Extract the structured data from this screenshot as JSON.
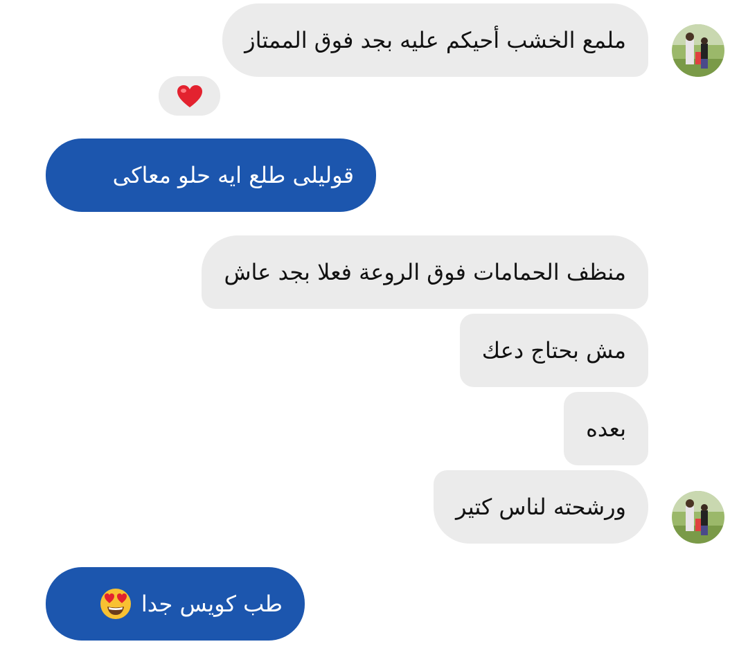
{
  "colors": {
    "incoming_bubble": "#ebebeb",
    "outgoing_bubble": "#1c56ae",
    "heart": "#e3222f",
    "emoji_face": "#f8c132"
  },
  "messages": [
    {
      "direction": "incoming",
      "text": "ملمع الخشب أحيكم عليه بجد فوق الممتاز",
      "reaction_icon": "red-heart-icon"
    },
    {
      "direction": "outgoing",
      "text": "قوليلى طلع ايه حلو معاكى"
    },
    {
      "direction": "incoming",
      "text": "منظف الحمامات فوق الروعة فعلا بجد عاش"
    },
    {
      "direction": "incoming",
      "text": "مش بحتاج دعك"
    },
    {
      "direction": "incoming",
      "text": "بعده"
    },
    {
      "direction": "incoming",
      "text": "ورشحته لناس كتير"
    },
    {
      "direction": "outgoing",
      "text": "طب كويس جدا",
      "emoji_icon": "heart-eyes-emoji-icon"
    }
  ]
}
